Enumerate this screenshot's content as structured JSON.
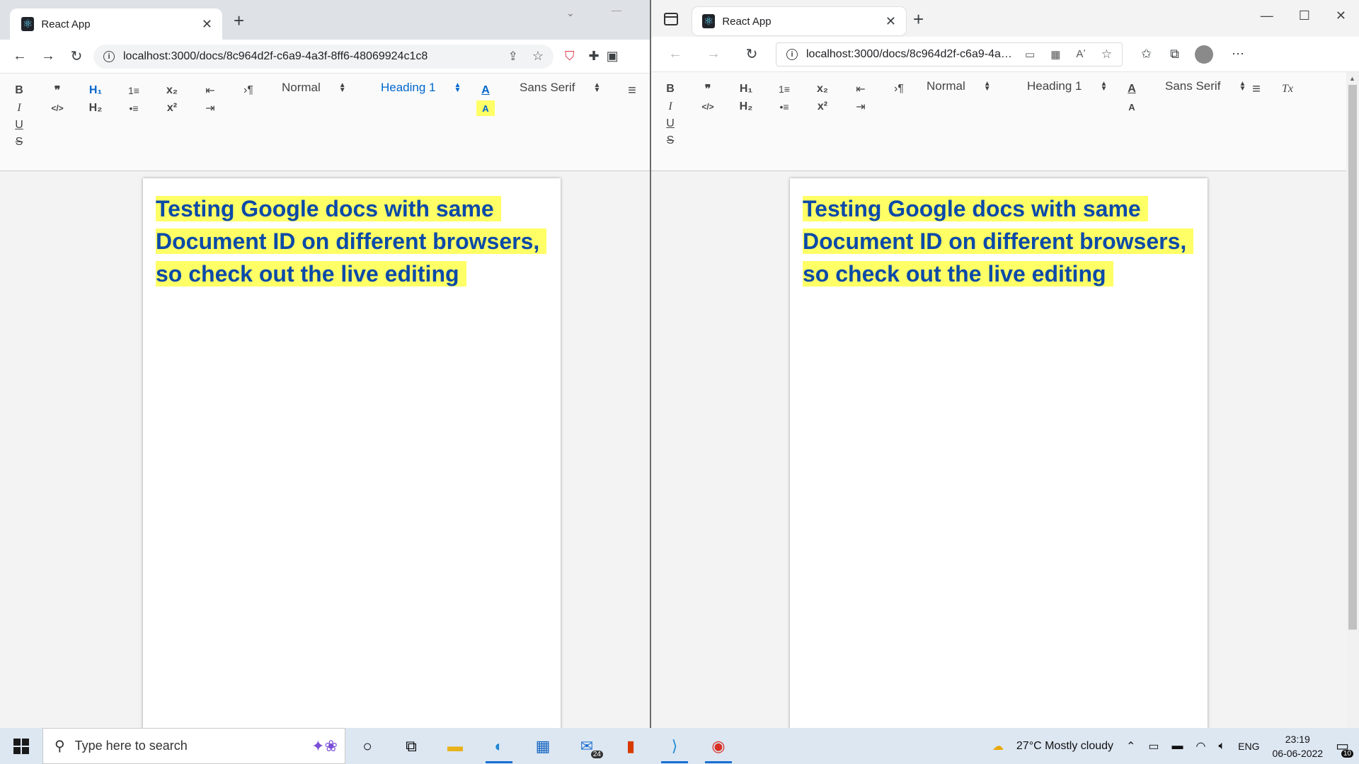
{
  "chrome": {
    "tab_title": "React App",
    "url": "localhost:3000/docs/8c964d2f-c6a9-4a3f-8ff6-48069924c1c8"
  },
  "edge": {
    "tab_title": "React App",
    "url": "localhost:3000/docs/8c964d2f-c6a9-4a3f..."
  },
  "toolbar": {
    "bold": "B",
    "italic": "I",
    "underline": "U",
    "strike": "S",
    "blockquote": "❞",
    "code_block": "</>",
    "h1": "H₁",
    "h2": "H₂",
    "ordered_list": "1≡",
    "bullet_list": "•≡",
    "subscript": "x₂",
    "superscript": "x²",
    "outdent": "⇤",
    "indent": "⇥",
    "direction": "›¶",
    "size_value": "Normal",
    "header_value": "Heading 1",
    "font_value": "Sans Serif",
    "color": "A",
    "background": "A",
    "align": "≡",
    "clean": "Tx"
  },
  "document": {
    "text": "Testing Google docs with same Document ID on different browsers, so check out the live editing"
  },
  "colors": {
    "heading_text": "#0b4aa8",
    "highlight": "#ffff66",
    "active_tool": "#0066cc"
  },
  "taskbar": {
    "search_placeholder": "Type here to search",
    "mail_badge": "24",
    "weather": "27°C  Mostly cloudy",
    "language": "ENG",
    "time": "23:19",
    "date": "06-06-2022",
    "notifications": "10"
  }
}
